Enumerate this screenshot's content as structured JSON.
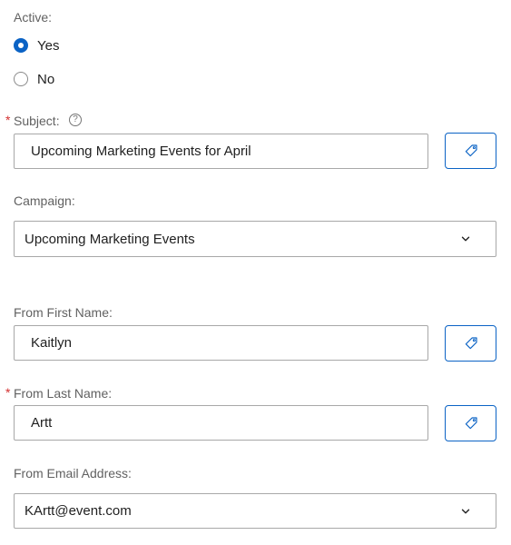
{
  "active": {
    "label": "Active:",
    "options": [
      {
        "label": "Yes",
        "checked": true
      },
      {
        "label": "No",
        "checked": false
      }
    ]
  },
  "subject": {
    "required_mark": "*",
    "label": "Subject:",
    "help_glyph": "?",
    "value": "Upcoming Marketing Events for April"
  },
  "campaign": {
    "label": "Campaign:",
    "selected": "Upcoming Marketing Events"
  },
  "from_first_name": {
    "label": "From First Name:",
    "value": "Kaitlyn"
  },
  "from_last_name": {
    "required_mark": "*",
    "label": "From Last Name:",
    "value": "Artt"
  },
  "from_email": {
    "label": "From Email Address:",
    "selected": "KArtt@event.com"
  },
  "colors": {
    "accent": "#0b63c5",
    "required": "#d32f2f",
    "label": "#616161",
    "border": "#a8a8a8"
  },
  "icons": {
    "tag_button": "tag-icon",
    "dropdown": "chevron-down-icon",
    "help": "help-icon"
  }
}
